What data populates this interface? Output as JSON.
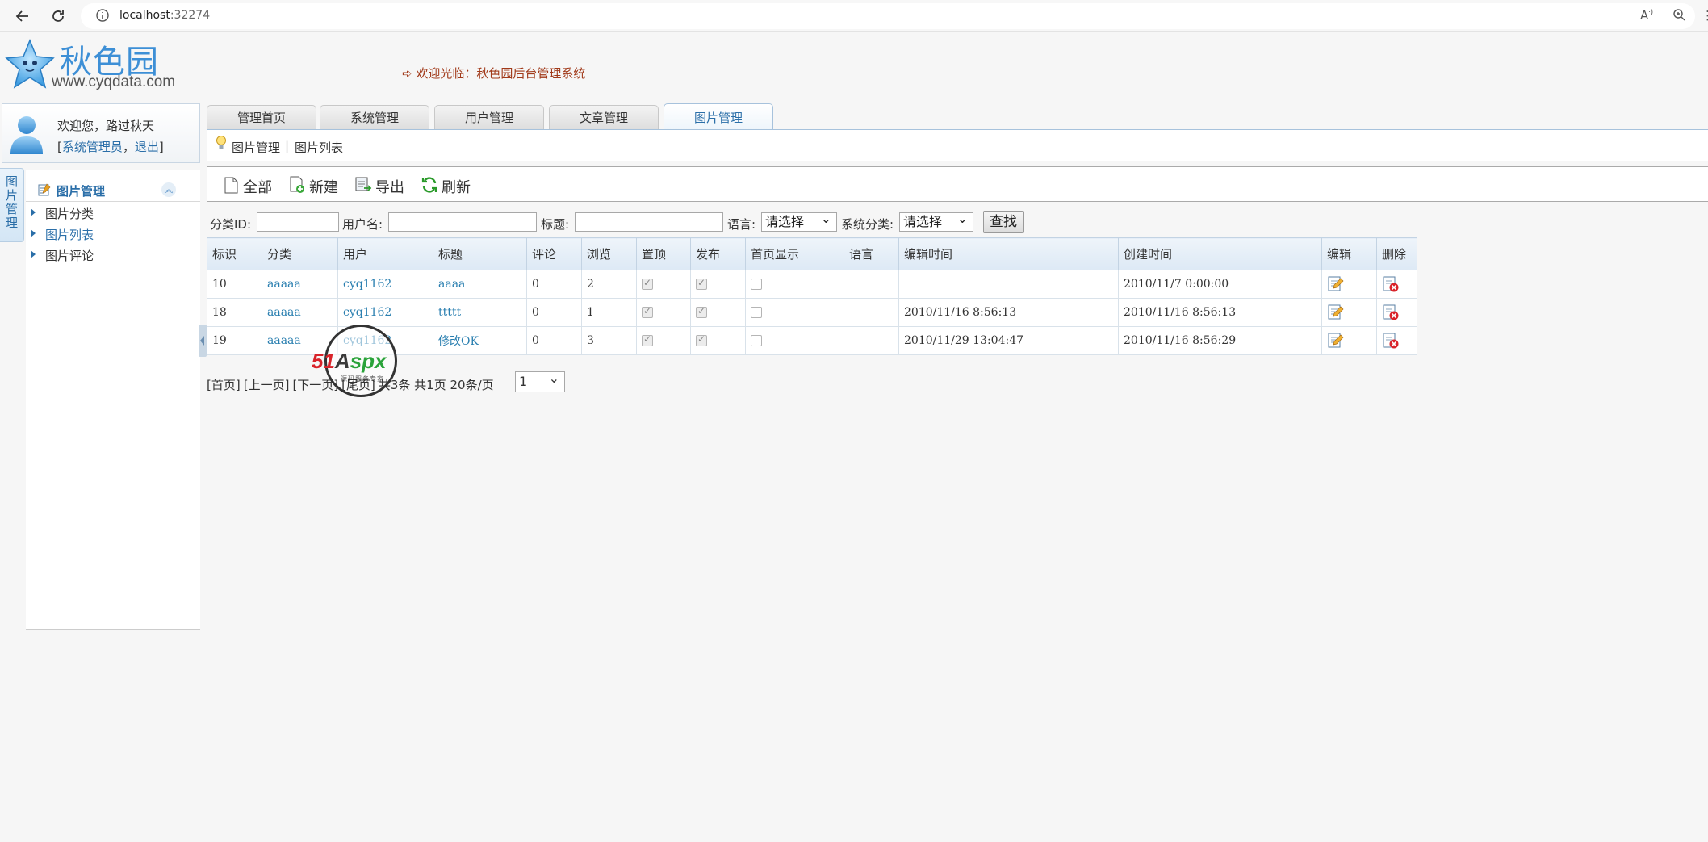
{
  "browser": {
    "url_host": "localhost",
    "url_port": ":32274"
  },
  "logo": {
    "title": "秋色园",
    "subtitle": "www.cyqdata.com"
  },
  "welcome_banner": "➪ 欢迎光临：秋色园后台管理系统",
  "user_panel": {
    "welcome_prefix": "欢迎您，",
    "username": "路过秋天",
    "bracket_open": "[",
    "role": "系统管理员",
    "comma": "，",
    "logout": "退出",
    "bracket_close": "]"
  },
  "side_tab": [
    "图",
    "片",
    "管",
    "理"
  ],
  "sidebar": {
    "title": "图片管理",
    "items": [
      {
        "label": "图片分类"
      },
      {
        "label": "图片列表"
      },
      {
        "label": "图片评论"
      }
    ]
  },
  "tabs": [
    {
      "label": "管理首页"
    },
    {
      "label": "系统管理"
    },
    {
      "label": "用户管理"
    },
    {
      "label": "文章管理"
    },
    {
      "label": "图片管理"
    }
  ],
  "breadcrumb": {
    "item1": "图片管理",
    "separator": "|",
    "item2": "图片列表"
  },
  "toolbar": {
    "all": "全部",
    "new": "新建",
    "export": "导出",
    "refresh": "刷新"
  },
  "search": {
    "category_id_label": "分类ID:",
    "category_id_value": "",
    "username_label": "用户名:",
    "username_value": "",
    "title_label": "标题:",
    "title_value": "",
    "language_label": "语言:",
    "language_selected": "请选择",
    "sys_category_label": "系统分类:",
    "sys_category_selected": "请选择",
    "search_button": "查找"
  },
  "table": {
    "headers": [
      "标识",
      "分类",
      "用户",
      "标题",
      "评论",
      "浏览",
      "置顶",
      "发布",
      "首页显示",
      "语言",
      "编辑时间",
      "创建时间",
      "编辑",
      "删除"
    ],
    "rows": [
      {
        "id": "10",
        "category": "aaaaa",
        "user": "cyq1162",
        "title": "aaaa",
        "comments": "0",
        "views": "2",
        "top": true,
        "publish": true,
        "home": false,
        "language": "",
        "edit_time": "",
        "create_time": "2010/11/7 0:00:00"
      },
      {
        "id": "18",
        "category": "aaaaa",
        "user": "cyq1162",
        "title": "ttttt",
        "comments": "0",
        "views": "1",
        "top": true,
        "publish": true,
        "home": false,
        "language": "",
        "edit_time": "2010/11/16 8:56:13",
        "create_time": "2010/11/16 8:56:13"
      },
      {
        "id": "19",
        "category": "aaaaa",
        "user": "cyq1162",
        "title": "修改OK",
        "comments": "0",
        "views": "3",
        "top": true,
        "publish": true,
        "home": false,
        "language": "",
        "edit_time": "2010/11/29 13:04:47",
        "create_time": "2010/11/16 8:56:29"
      }
    ]
  },
  "pager": {
    "first": "[首页]",
    "prev": "[上一页]",
    "next": "[下一页]",
    "last": "[尾页]",
    "summary": "共3条 共1页 20条/页",
    "page_selected": "1"
  },
  "watermark": {
    "text_51": "51",
    "text_a": "A",
    "text_spx": "spx",
    "sub": "源码服务专家"
  },
  "colors": {
    "link": "#2a6ea8",
    "banner": "#a13a1a",
    "tab_active_border": "#a7c2dc"
  }
}
